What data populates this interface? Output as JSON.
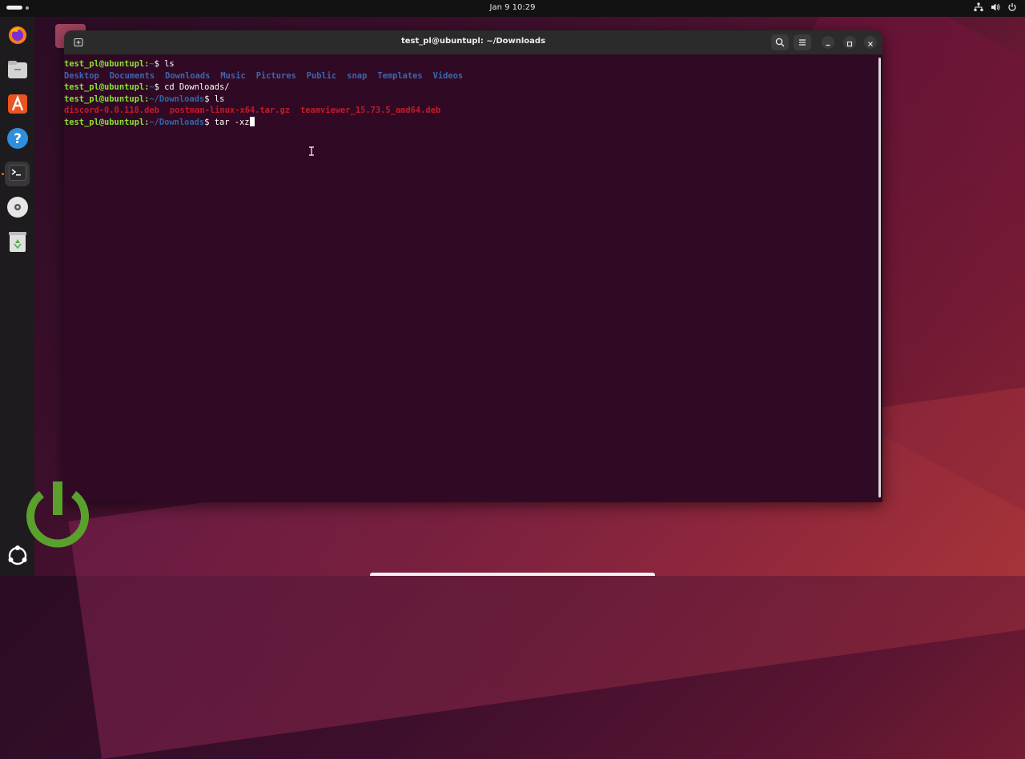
{
  "topbar": {
    "clock": "Jan 9  10:29"
  },
  "dock": {
    "items": [
      {
        "name": "firefox-icon"
      },
      {
        "name": "files-icon"
      },
      {
        "name": "app-center-icon"
      },
      {
        "name": "help-icon"
      },
      {
        "name": "terminal-icon"
      },
      {
        "name": "disc-icon"
      },
      {
        "name": "trash-icon"
      },
      {
        "name": "show-apps-icon"
      }
    ]
  },
  "window": {
    "title": "test_pl@ubuntupl: ~/Downloads"
  },
  "terminal": {
    "user": "test_pl@ubuntupl",
    "home_path": "~",
    "downloads_path": "~/Downloads",
    "cmd_ls": "ls",
    "cmd_cd": "cd Downloads/",
    "cmd_current": "tar -xz",
    "home_dirs": [
      "Desktop",
      "Documents",
      "Downloads",
      "Music",
      "Pictures",
      "Public",
      "snap",
      "Templates",
      "Videos"
    ],
    "download_files": [
      "discord-0.0.118.deb",
      "postman-linux-x64.tar.gz",
      "teamviewer_15.73.5_amd64.deb"
    ],
    "prompt_suffix": "$ ",
    "colon": ":"
  },
  "colors": {
    "terminal_bg": "#300a24",
    "prompt_user": "#8ae234",
    "prompt_path": "#3465a4",
    "directory": "#3d66b0",
    "deb_file": "#c41a2a",
    "power_logo": "#5aa02c"
  }
}
